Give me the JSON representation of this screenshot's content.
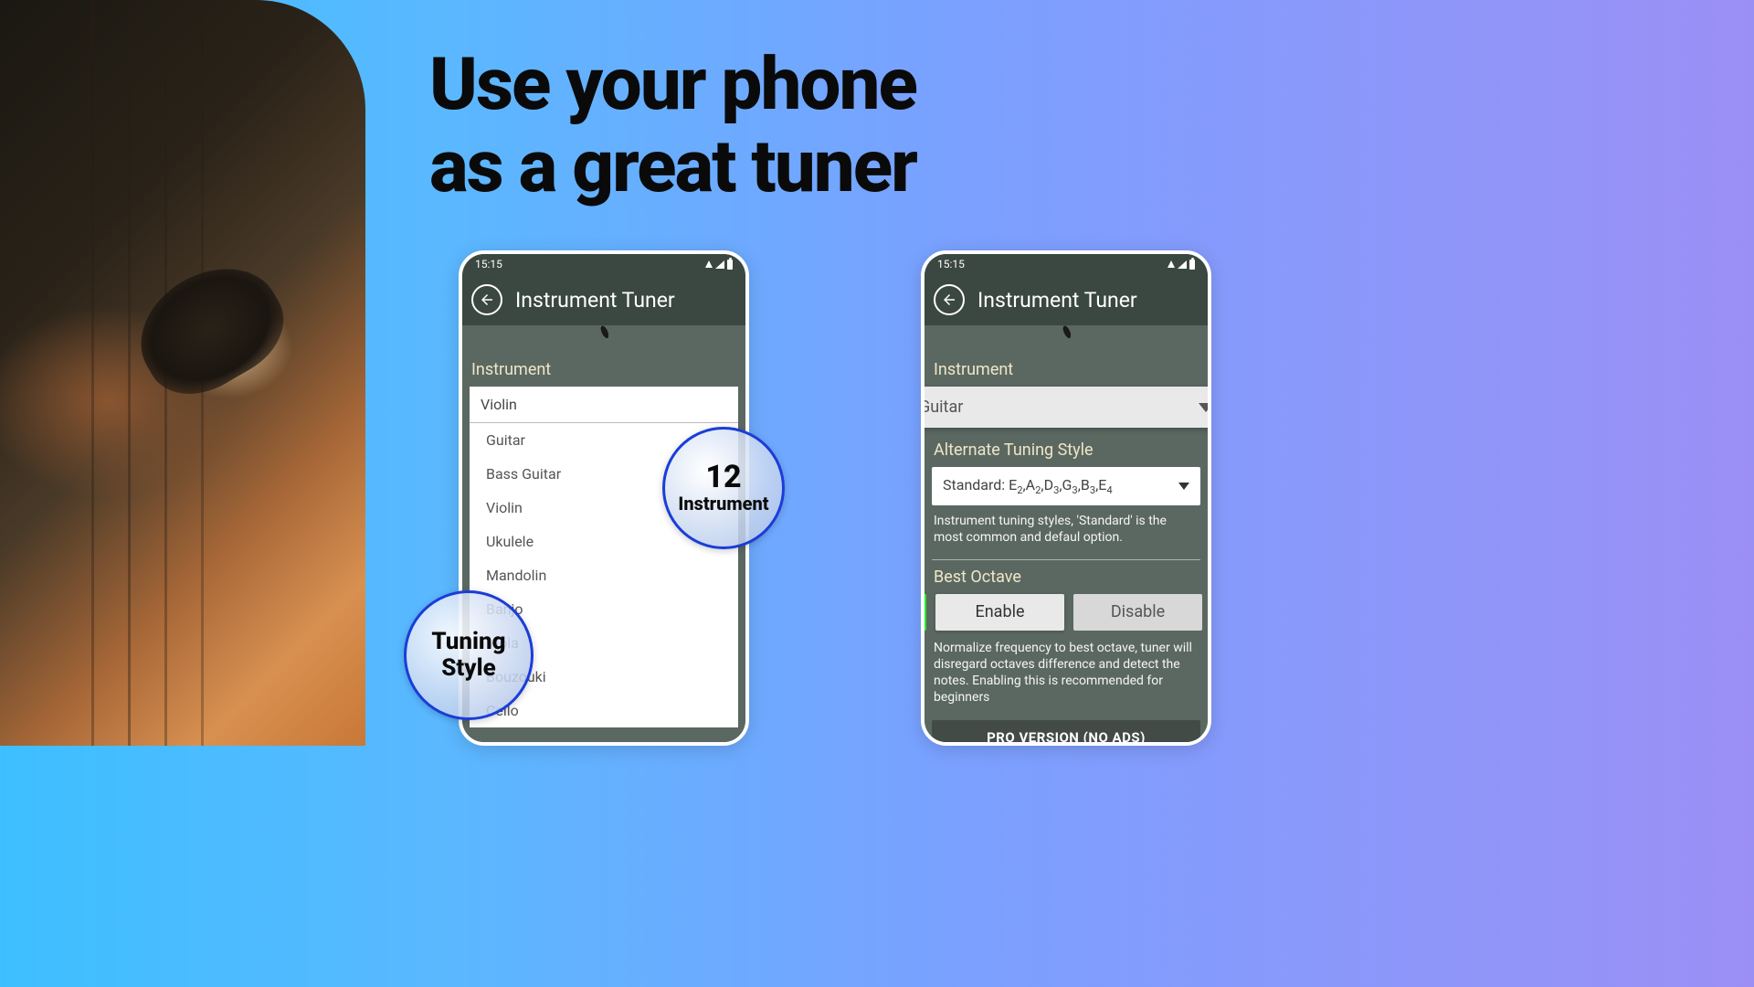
{
  "headline": "Use your phone\nas a great tuner",
  "statusbar": {
    "time": "15:15"
  },
  "appbar": {
    "title": "Instrument Tuner"
  },
  "sections": {
    "instrument": "Instrument",
    "alternate": "Alternate Tuning Style",
    "best_octave": "Best Octave"
  },
  "phoneA": {
    "selected": "Violin",
    "items": [
      "Guitar",
      "Bass Guitar",
      "Violin",
      "Ukulele",
      "Mandolin",
      "Banjo",
      "Viola",
      "Bouzouki",
      "Cello"
    ]
  },
  "phoneB": {
    "instrument_value": "Guitar",
    "tuning_prefix": "Standard: ",
    "tuning_notes": [
      [
        "E",
        "2"
      ],
      [
        "A",
        "2"
      ],
      [
        "D",
        "3"
      ],
      [
        "G",
        "3"
      ],
      [
        "B",
        "3"
      ],
      [
        "E",
        "4"
      ]
    ],
    "tuning_desc": "Instrument tuning styles, 'Standard' is the most common and defaul option.",
    "enable": "Enable",
    "disable": "Disable",
    "octave_desc": "Normalize frequency to best octave, tuner will disregard octaves difference and detect the notes. Enabling this is recommended for beginners",
    "pro_banner": "PRO VERSION (NO ADS)"
  },
  "bubbles": {
    "count_num": "12",
    "count_label": "Instrument",
    "style_line1": "Tuning",
    "style_line2": "Style"
  }
}
